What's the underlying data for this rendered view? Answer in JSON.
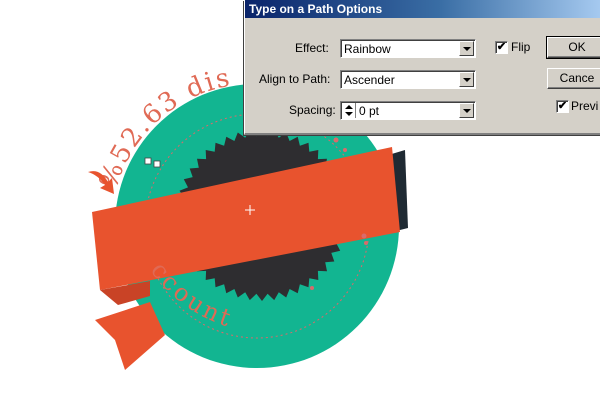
{
  "artwork": {
    "arc_text_top": "%52.63 dis",
    "arc_text_bottom": "ccount",
    "colors": {
      "teal": "#12b591",
      "dark_circle": "#2e2d30",
      "ribbon": "#e8532e",
      "ribbon_shadow": "#1f2a33",
      "text": "#e06a55"
    }
  },
  "dialog": {
    "title": "Type on a Path Options",
    "effect_label": "Effect:",
    "effect_value": "Rainbow",
    "align_label": "Align to Path:",
    "align_value": "Ascender",
    "spacing_label": "Spacing:",
    "spacing_value": "0 pt",
    "flip_label": "Flip",
    "flip_checked": "✔",
    "ok_label": "OK",
    "cancel_label": "Cance",
    "preview_label": "Previ",
    "preview_checked": "✔"
  }
}
